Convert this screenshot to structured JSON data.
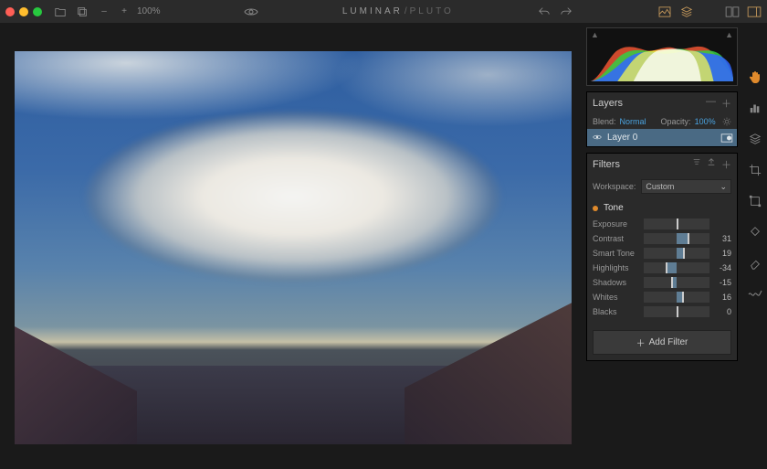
{
  "topbar": {
    "zoom_minus": "–",
    "zoom_plus": "+",
    "zoom_value": "100%",
    "brand_main": "LUMINAR",
    "brand_sub": "/PLUTO"
  },
  "histogram": {
    "clip_left": "▲",
    "clip_right": "▲"
  },
  "layers": {
    "title": "Layers",
    "blend_label": "Blend:",
    "blend_value": "Normal",
    "opacity_label": "Opacity:",
    "opacity_value": "100%",
    "item0": {
      "name": "Layer 0"
    }
  },
  "filters": {
    "title": "Filters",
    "workspace_label": "Workspace:",
    "workspace_value": "Custom",
    "tone": {
      "title": "Tone",
      "sliders": {
        "exposure": {
          "label": "Exposure",
          "value": "",
          "pct": 50
        },
        "contrast": {
          "label": "Contrast",
          "value": "31",
          "pct": 66
        },
        "smart_tone": {
          "label": "Smart Tone",
          "value": "19",
          "pct": 60
        },
        "highlights": {
          "label": "Highlights",
          "value": "-34",
          "pct": 33
        },
        "shadows": {
          "label": "Shadows",
          "value": "-15",
          "pct": 42
        },
        "whites": {
          "label": "Whites",
          "value": "16",
          "pct": 58
        },
        "blacks": {
          "label": "Blacks",
          "value": "0",
          "pct": 50
        }
      }
    },
    "add_filter": "Add Filter"
  }
}
